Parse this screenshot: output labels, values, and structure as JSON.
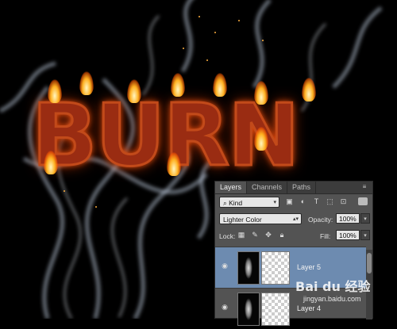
{
  "artwork": {
    "text": "BURN"
  },
  "layers_panel": {
    "tabs": [
      {
        "label": "Layers",
        "active": true
      },
      {
        "label": "Channels",
        "active": false
      },
      {
        "label": "Paths",
        "active": false
      }
    ],
    "filter": {
      "label": "Kind"
    },
    "blend": {
      "mode": "Lighter Color",
      "opacity_label": "Opacity:",
      "opacity_value": "100%"
    },
    "lock": {
      "label": "Lock:",
      "fill_label": "Fill:",
      "fill_value": "100%"
    },
    "layers": [
      {
        "name": "Layer 5",
        "selected": true,
        "visible": true
      },
      {
        "name": "Layer 4",
        "selected": false,
        "visible": true
      }
    ]
  },
  "watermark": {
    "logo": "Bai du 经验",
    "url": "jingyan.baidu.com"
  },
  "colors": {
    "panel_bg": "#535353",
    "selected_layer": "#6d8bb0",
    "tab_bar": "#3c3c3c"
  },
  "icons": [
    "search-icon",
    "image-filter-icon",
    "adjustment-filter-icon",
    "type-filter-icon",
    "shape-filter-icon",
    "smart-object-filter-icon",
    "eye-icon",
    "lock-pixels-icon",
    "brush-icon",
    "move-icon",
    "lock-icon",
    "panel-menu-icon"
  ]
}
